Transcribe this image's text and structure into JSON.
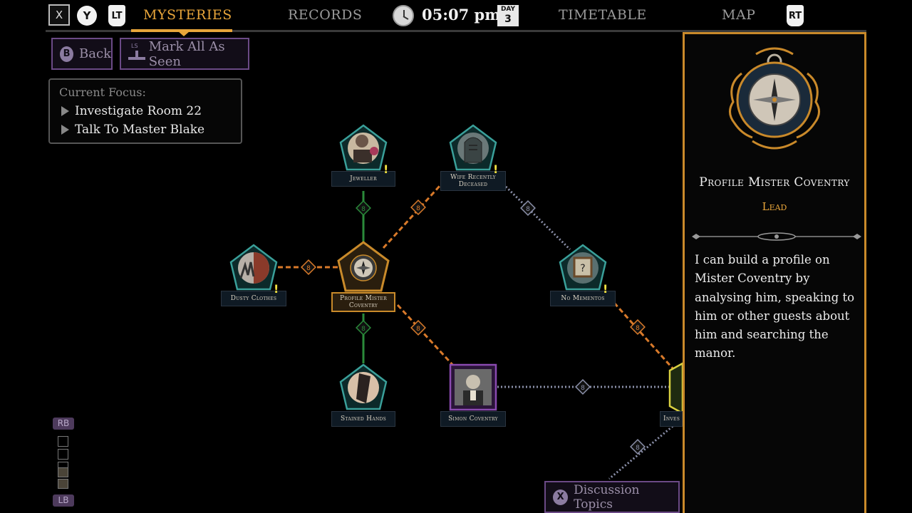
{
  "nav": {
    "btn_x": "X",
    "btn_y": "Y",
    "btn_lt": "LT",
    "btn_rt": "RT",
    "tabs": [
      {
        "label": "MYSTERIES",
        "active": true
      },
      {
        "label": "RECORDS",
        "active": false
      },
      {
        "label": "TIMETABLE",
        "active": false
      },
      {
        "label": "MAP",
        "active": false
      }
    ],
    "time": "05:07 pm",
    "day_label": "DAY",
    "day_number": "3"
  },
  "actions": {
    "back_glyph": "B",
    "back_label": "Back",
    "mark_glyph": "LS",
    "mark_label": "Mark All As Seen"
  },
  "focus": {
    "title": "Current Focus:",
    "items": [
      "Investigate Room 22",
      "Talk To Master Blake"
    ]
  },
  "nodes": {
    "jeweller": "Jeweller",
    "wife": "Wife Recently Deceased",
    "dusty": "Dusty Clothes",
    "profile": "Profile Mister Coventry",
    "mementos": "No Mementos",
    "stained": "Stained Hands",
    "simon": "Simon Coventry",
    "investigate_partial": "Inves"
  },
  "layers": {
    "top": "RB",
    "bottom": "LB",
    "filled_levels": 2,
    "total_levels": 5
  },
  "discussion": {
    "glyph": "X",
    "label": "Discussion Topics"
  },
  "panel": {
    "title": "Profile Mister Coventry",
    "subtitle": "Lead",
    "body": "I can build a profile on Mister Coventry by analysing him, speaking to him or other guests about him and searching the manor."
  },
  "colors": {
    "accent": "#e8a53a",
    "orange_link": "#d97a2a",
    "green_link": "#2a8a3a",
    "dotted_link": "#8a8fa8",
    "teal_frame": "#3aa09a",
    "purple_frame": "#8a4ab0",
    "button_border": "#6b4a86"
  }
}
